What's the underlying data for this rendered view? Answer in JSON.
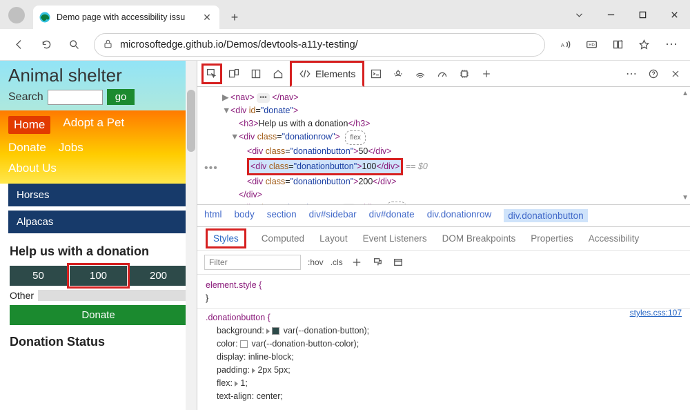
{
  "tab": {
    "title": "Demo page with accessibility issu"
  },
  "url": "microsoftedge.github.io/Demos/devtools-a11y-testing/",
  "page": {
    "title": "Animal shelter",
    "search_label": "Search",
    "go": "go",
    "nav": {
      "home": "Home",
      "adopt": "Adopt a Pet",
      "donate": "Donate",
      "jobs": "Jobs",
      "about": "About Us"
    },
    "side": [
      "Horses",
      "Alpacas"
    ],
    "donate_heading": "Help us with a donation",
    "amounts": [
      "50",
      "100",
      "200"
    ],
    "other": "Other",
    "donate_btn": "Donate",
    "status_heading": "Donation Status"
  },
  "devtools": {
    "tab_elements": "Elements",
    "crumbs": [
      "html",
      "body",
      "section",
      "div#sidebar",
      "div#donate",
      "div.donationrow",
      "div.donationbutton"
    ],
    "styles_tabs": [
      "Styles",
      "Computed",
      "Layout",
      "Event Listeners",
      "DOM Breakpoints",
      "Properties",
      "Accessibility"
    ],
    "filter_ph": "Filter",
    "hov": ":hov",
    "cls": ".cls",
    "dom": {
      "nav_open": "nav",
      "nav_close": "nav",
      "div_donate": "donate",
      "h3_text": "Help us with a donation",
      "row_class": "donationrow",
      "btn_class": "donationbutton",
      "v50": "50",
      "v100": "100",
      "v200": "200",
      "eq0": "== $0",
      "flex": "flex"
    },
    "css": {
      "element_style": "element.style {",
      "close": "}",
      "rule": ".donationbutton {",
      "bg": "background:",
      "bg_val": "var(--donation-button);",
      "color": "color:",
      "color_val": "var(--donation-button-color);",
      "display": "display:",
      "display_val": "inline-block;",
      "padding": "padding:",
      "padding_val": "2px 5px;",
      "flexp": "flex:",
      "flex_val": "1;",
      "ta": "text-align:",
      "ta_val": "center;",
      "link": "styles.css:107"
    }
  }
}
